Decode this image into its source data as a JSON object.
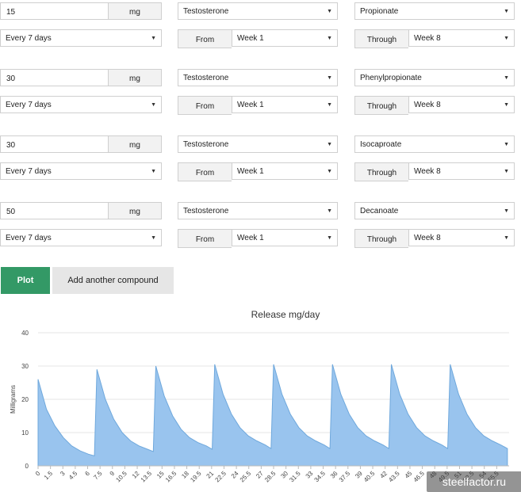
{
  "compounds": [
    {
      "dose": "15",
      "unit": "mg",
      "drug": "Testosterone",
      "ester": "Propionate",
      "frequency": "Every 7 days",
      "from_label": "From",
      "from": "Week 1",
      "through_label": "Through",
      "through": "Week 8"
    },
    {
      "dose": "30",
      "unit": "mg",
      "drug": "Testosterone",
      "ester": "Phenylpropionate",
      "frequency": "Every 7 days",
      "from_label": "From",
      "from": "Week 1",
      "through_label": "Through",
      "through": "Week 8"
    },
    {
      "dose": "30",
      "unit": "mg",
      "drug": "Testosterone",
      "ester": "Isocaproate",
      "frequency": "Every 7 days",
      "from_label": "From",
      "from": "Week 1",
      "through_label": "Through",
      "through": "Week 8"
    },
    {
      "dose": "50",
      "unit": "mg",
      "drug": "Testosterone",
      "ester": "Decanoate",
      "frequency": "Every 7 days",
      "from_label": "From",
      "from": "Week 1",
      "through_label": "Through",
      "through": "Week 8"
    }
  ],
  "buttons": {
    "plot": "Plot",
    "add": "Add another compound"
  },
  "watermark": "steelfactor.ru",
  "colors": {
    "plot_button": "#339966",
    "area_fill": "#99c4ee",
    "area_line": "#6fa8dc"
  },
  "chart_data": {
    "type": "area",
    "title": "Release mg/day",
    "ylabel": "Milligrams",
    "xlabel": "",
    "ylim": [
      0,
      40
    ],
    "yticks": [
      0,
      10,
      20,
      30,
      40
    ],
    "xlim": [
      0,
      56
    ],
    "xticks": [
      "0",
      "1.5",
      "3",
      "4.5",
      "6",
      "7.5",
      "9",
      "10.5",
      "12",
      "13.5",
      "15",
      "16.5",
      "18",
      "19.5",
      "21",
      "22.5",
      "24",
      "25.5",
      "27",
      "28.5",
      "30",
      "31.5",
      "33",
      "34.5",
      "36",
      "37.5",
      "39",
      "40.5",
      "42",
      "43.5",
      "45",
      "46.5",
      "48",
      "49.5",
      "51",
      "52.5",
      "54",
      "55.5"
    ],
    "grid": true,
    "series": [
      {
        "points": [
          [
            0,
            26
          ],
          [
            1,
            17
          ],
          [
            2,
            12
          ],
          [
            3,
            8.5
          ],
          [
            4,
            6
          ],
          [
            5,
            4.5
          ],
          [
            6,
            3.5
          ],
          [
            6.7,
            3
          ],
          [
            7,
            29
          ],
          [
            8,
            20
          ],
          [
            9,
            14
          ],
          [
            10,
            10
          ],
          [
            11,
            7.5
          ],
          [
            12,
            6
          ],
          [
            13,
            5
          ],
          [
            13.7,
            4.3
          ],
          [
            14,
            30
          ],
          [
            15,
            21
          ],
          [
            16,
            15
          ],
          [
            17,
            11
          ],
          [
            18,
            8.5
          ],
          [
            19,
            7
          ],
          [
            20,
            6
          ],
          [
            20.7,
            5
          ],
          [
            21,
            30.5
          ],
          [
            22,
            21.5
          ],
          [
            23,
            15.5
          ],
          [
            24,
            11.5
          ],
          [
            25,
            9
          ],
          [
            26,
            7.5
          ],
          [
            27,
            6.3
          ],
          [
            27.7,
            5.2
          ],
          [
            28,
            30.5
          ],
          [
            29,
            21.5
          ],
          [
            30,
            15.5
          ],
          [
            31,
            11.5
          ],
          [
            32,
            9
          ],
          [
            33,
            7.5
          ],
          [
            34,
            6.3
          ],
          [
            34.7,
            5.2
          ],
          [
            35,
            30.5
          ],
          [
            36,
            21.5
          ],
          [
            37,
            15.5
          ],
          [
            38,
            11.5
          ],
          [
            39,
            9
          ],
          [
            40,
            7.5
          ],
          [
            41,
            6.3
          ],
          [
            41.7,
            5.2
          ],
          [
            42,
            30.5
          ],
          [
            43,
            21.5
          ],
          [
            44,
            15.5
          ],
          [
            45,
            11.5
          ],
          [
            46,
            9
          ],
          [
            47,
            7.5
          ],
          [
            48,
            6.3
          ],
          [
            48.7,
            5.2
          ],
          [
            49,
            30.5
          ],
          [
            50,
            21.5
          ],
          [
            51,
            15.5
          ],
          [
            52,
            11.5
          ],
          [
            53,
            9
          ],
          [
            54,
            7.5
          ],
          [
            55,
            6.3
          ],
          [
            55.8,
            5.2
          ]
        ]
      }
    ]
  }
}
